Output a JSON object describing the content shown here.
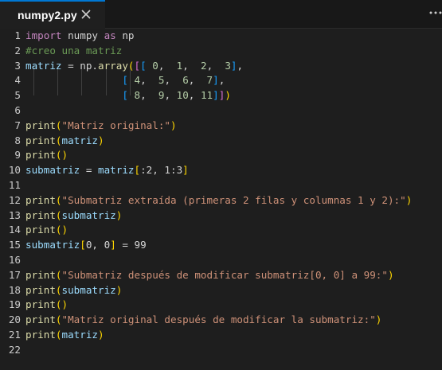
{
  "tab": {
    "filename": "numpy2.py"
  },
  "icons": {
    "close": "close-icon",
    "more": "more-actions-icon"
  },
  "lines": [
    {
      "n": "1",
      "tokens": [
        [
          "import",
          "kw"
        ],
        [
          " numpy ",
          "op"
        ],
        [
          "as",
          "kw"
        ],
        [
          " np",
          "op"
        ]
      ]
    },
    {
      "n": "2",
      "tokens": [
        [
          "#creo una matriz",
          "cm"
        ]
      ]
    },
    {
      "n": "3",
      "tokens": [
        [
          "matriz",
          "var"
        ],
        [
          " = np.",
          "op"
        ],
        [
          "array",
          "fn"
        ],
        [
          "(",
          "br1"
        ],
        [
          "[",
          "br2"
        ],
        [
          "[",
          "br3"
        ],
        [
          " ",
          "op"
        ],
        [
          "0",
          "num"
        ],
        [
          ",  ",
          "op"
        ],
        [
          "1",
          "num"
        ],
        [
          ",  ",
          "op"
        ],
        [
          "2",
          "num"
        ],
        [
          ",  ",
          "op"
        ],
        [
          "3",
          "num"
        ],
        [
          "]",
          "br3"
        ],
        [
          ",",
          "op"
        ]
      ]
    },
    {
      "n": "4",
      "tokens": [
        [
          "                ",
          "op"
        ],
        [
          "[",
          "br3"
        ],
        [
          " ",
          "op"
        ],
        [
          "4",
          "num"
        ],
        [
          ",  ",
          "op"
        ],
        [
          "5",
          "num"
        ],
        [
          ",  ",
          "op"
        ],
        [
          "6",
          "num"
        ],
        [
          ",  ",
          "op"
        ],
        [
          "7",
          "num"
        ],
        [
          "]",
          "br3"
        ],
        [
          ",",
          "op"
        ]
      ]
    },
    {
      "n": "5",
      "tokens": [
        [
          "                ",
          "op"
        ],
        [
          "[",
          "br3"
        ],
        [
          " ",
          "op"
        ],
        [
          "8",
          "num"
        ],
        [
          ",  ",
          "op"
        ],
        [
          "9",
          "num"
        ],
        [
          ", ",
          "op"
        ],
        [
          "10",
          "num"
        ],
        [
          ", ",
          "op"
        ],
        [
          "11",
          "num"
        ],
        [
          "]",
          "br3"
        ],
        [
          "]",
          "br2"
        ],
        [
          ")",
          "br1"
        ]
      ]
    },
    {
      "n": "6",
      "tokens": []
    },
    {
      "n": "7",
      "tokens": [
        [
          "print",
          "fn"
        ],
        [
          "(",
          "br1"
        ],
        [
          "\"Matriz original:\"",
          "str"
        ],
        [
          ")",
          "br1"
        ]
      ]
    },
    {
      "n": "8",
      "tokens": [
        [
          "print",
          "fn"
        ],
        [
          "(",
          "br1"
        ],
        [
          "matriz",
          "var"
        ],
        [
          ")",
          "br1"
        ]
      ]
    },
    {
      "n": "9",
      "tokens": [
        [
          "print",
          "fn"
        ],
        [
          "()",
          "br1"
        ]
      ]
    },
    {
      "n": "10",
      "tokens": [
        [
          "submatriz",
          "var"
        ],
        [
          " = ",
          "op"
        ],
        [
          "matriz",
          "var"
        ],
        [
          "[",
          "br1"
        ],
        [
          ":2, 1:3",
          "op"
        ],
        [
          "]",
          "br1"
        ]
      ]
    },
    {
      "n": "11",
      "tokens": []
    },
    {
      "n": "12",
      "tokens": [
        [
          "print",
          "fn"
        ],
        [
          "(",
          "br1"
        ],
        [
          "\"Submatriz extraída (primeras 2 filas y columnas 1 y 2):\"",
          "str"
        ],
        [
          ")",
          "br1"
        ]
      ]
    },
    {
      "n": "13",
      "tokens": [
        [
          "print",
          "fn"
        ],
        [
          "(",
          "br1"
        ],
        [
          "submatriz",
          "var"
        ],
        [
          ")",
          "br1"
        ]
      ]
    },
    {
      "n": "14",
      "tokens": [
        [
          "print",
          "fn"
        ],
        [
          "()",
          "br1"
        ]
      ]
    },
    {
      "n": "15",
      "tokens": [
        [
          "submatriz",
          "var"
        ],
        [
          "[",
          "br1"
        ],
        [
          "0, 0",
          "op"
        ],
        [
          "]",
          "br1"
        ],
        [
          " = 99",
          "op"
        ]
      ]
    },
    {
      "n": "16",
      "tokens": []
    },
    {
      "n": "17",
      "tokens": [
        [
          "print",
          "fn"
        ],
        [
          "(",
          "br1"
        ],
        [
          "\"Submatriz después de modificar submatriz[0, 0] a 99:\"",
          "str"
        ],
        [
          ")",
          "br1"
        ]
      ]
    },
    {
      "n": "18",
      "tokens": [
        [
          "print",
          "fn"
        ],
        [
          "(",
          "br1"
        ],
        [
          "submatriz",
          "var"
        ],
        [
          ")",
          "br1"
        ]
      ]
    },
    {
      "n": "19",
      "tokens": [
        [
          "print",
          "fn"
        ],
        [
          "()",
          "br1"
        ]
      ]
    },
    {
      "n": "20",
      "tokens": [
        [
          "print",
          "fn"
        ],
        [
          "(",
          "br1"
        ],
        [
          "\"Matriz original después de modificar la submatriz:\"",
          "str"
        ],
        [
          ")",
          "br1"
        ]
      ]
    },
    {
      "n": "21",
      "tokens": [
        [
          "print",
          "fn"
        ],
        [
          "(",
          "br1"
        ],
        [
          "matriz",
          "var"
        ],
        [
          ")",
          "br1"
        ]
      ]
    },
    {
      "n": "22",
      "tokens": []
    }
  ]
}
